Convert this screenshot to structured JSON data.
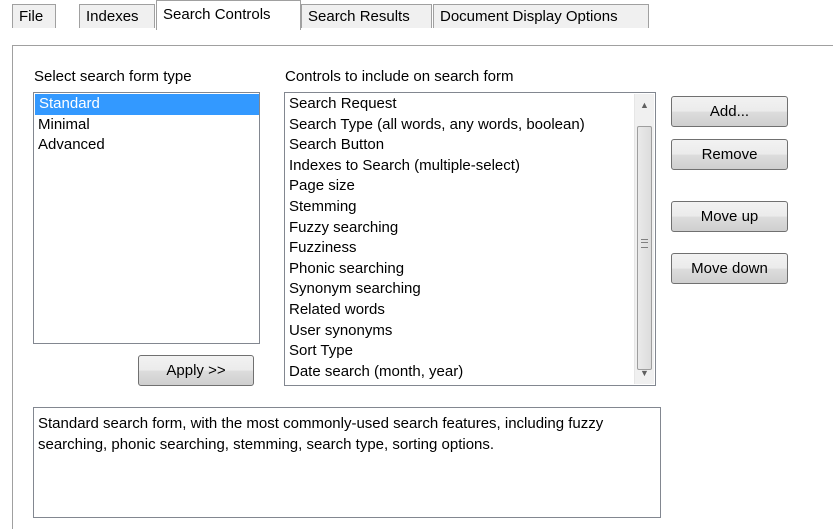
{
  "tabs": [
    {
      "label": "File",
      "active": false
    },
    {
      "label": "Indexes",
      "active": false
    },
    {
      "label": "Search Controls",
      "active": true
    },
    {
      "label": "Search Results",
      "active": false
    },
    {
      "label": "Document Display Options",
      "active": false
    }
  ],
  "form_type": {
    "label": "Select search form type",
    "items": [
      "Standard",
      "Minimal",
      "Advanced"
    ],
    "selected": "Standard"
  },
  "controls": {
    "label": "Controls to include on search form",
    "items": [
      "Search Request",
      "Search Type (all words, any words, boolean)",
      "Search Button",
      "Indexes to Search (multiple-select)",
      "Page size",
      "Stemming",
      "Fuzzy searching",
      "Fuzziness",
      "Phonic searching",
      "Synonym searching",
      "Related words",
      "User synonyms",
      "Sort Type",
      "Date search (month, year)"
    ]
  },
  "buttons": {
    "apply": "Apply >>",
    "add": "Add...",
    "remove": "Remove",
    "move_up": "Move up",
    "move_down": "Move down"
  },
  "description": "Standard search form, with the most commonly-used search features, including fuzzy searching, phonic searching, stemming, search type, sorting options.",
  "colors": {
    "selection": "#3399ff",
    "border": "#828790"
  }
}
